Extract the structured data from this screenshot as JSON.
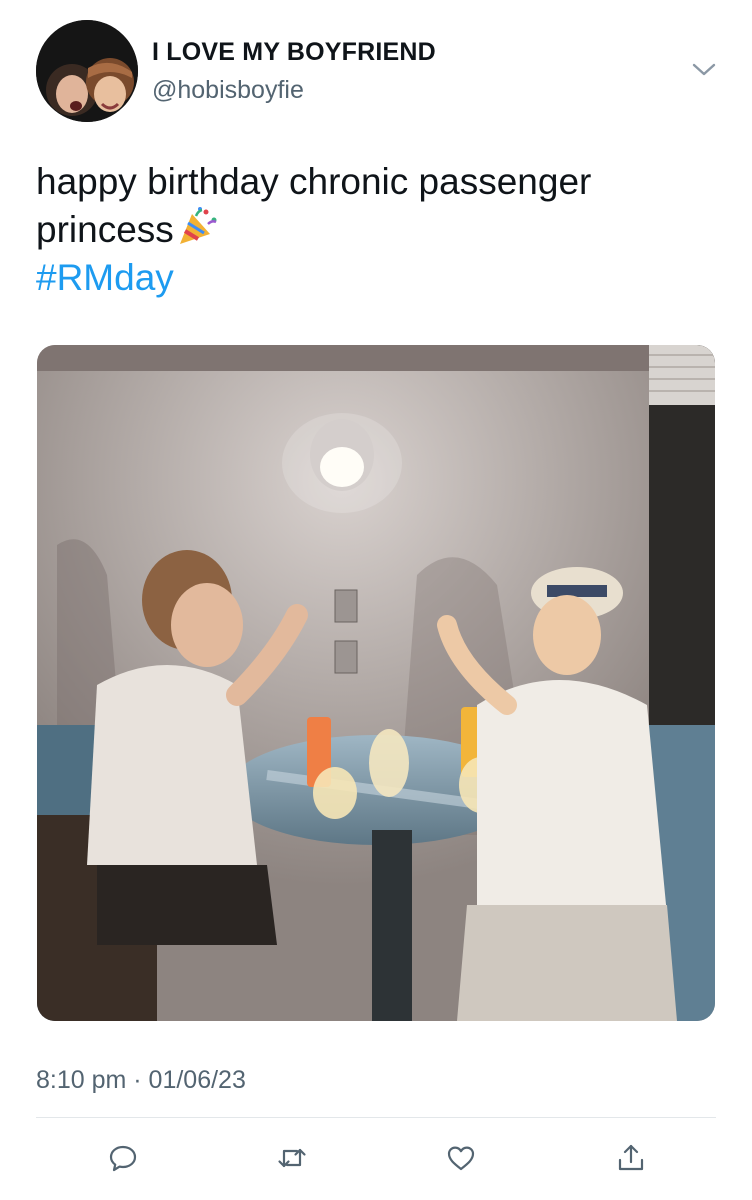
{
  "tweet": {
    "display_name": "I LOVE MY BOYFRIEND",
    "handle": "@hobisboyfie",
    "text_line1": "happy birthday chronic passenger",
    "text_line2": "princess",
    "emoji": "party-popper-icon",
    "hashtag": "#RMday",
    "timestamp": "8:10 pm · 01/06/23"
  },
  "actions": [
    "reply-icon",
    "retweet-icon",
    "like-icon",
    "share-icon"
  ],
  "colors": {
    "text": "#0f1419",
    "secondary": "#536471",
    "link": "#1d9bf0",
    "divider": "#e3e7ea"
  }
}
